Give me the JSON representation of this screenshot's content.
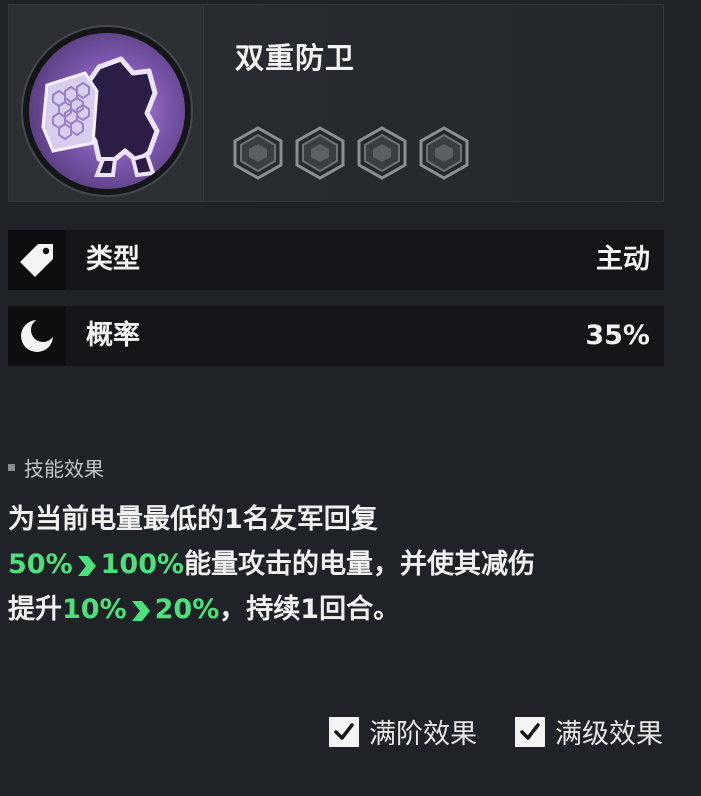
{
  "skill": {
    "name": "双重防卫",
    "level_slots": 4,
    "level_filled": 0
  },
  "stats": [
    {
      "icon": "tag-icon",
      "label": "类型",
      "value": "主动"
    },
    {
      "icon": "moon-icon",
      "label": "概率",
      "value": "35%"
    }
  ],
  "effect": {
    "section_title": "技能效果",
    "line1": "为当前电量最低的1名友军回复",
    "heal_min": "50%",
    "heal_max": "100%",
    "line2_text": "能量攻击的电量，并使其减伤",
    "line3_prefix": "提升",
    "reduce_min": "10%",
    "reduce_max": "20%",
    "line3_suffix": "，持续1回合。",
    "highlight_color": "#4ee07a"
  },
  "toggles": [
    {
      "label": "满阶效果",
      "checked": true
    },
    {
      "label": "满级效果",
      "checked": true
    }
  ]
}
